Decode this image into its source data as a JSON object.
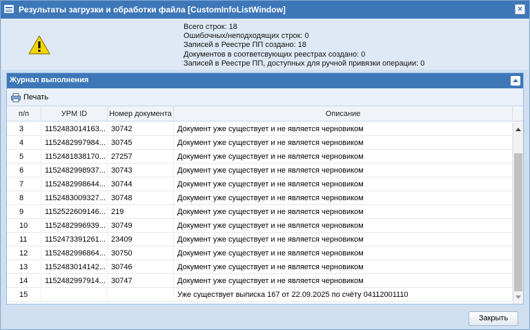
{
  "window": {
    "title": "Результаты загрузки и обработки файла [CustomInfoListWindow]"
  },
  "summary": {
    "lines": [
      "Всего строк: 18",
      "Ошибочных/неподходящих строк: 0",
      "Записей в Реестре ПП создано: 18",
      "Документов в соответсвующих реестрах создано: 0",
      "Записей в Реестре ПП, доступных для ручной привязки операции: 0"
    ],
    "icon": "warning-icon"
  },
  "journal": {
    "title": "Журнал выполнения",
    "toolbar": {
      "print_label": "Печать"
    },
    "columns": [
      "п/п",
      "УРМ ID",
      "Номер документа",
      "Описание"
    ],
    "rows": [
      {
        "num": "3",
        "uid": "1152483014163...",
        "doc": "30742",
        "desc": "Документ уже существует и не является черновиком"
      },
      {
        "num": "4",
        "uid": "1152482997984...",
        "doc": "30745",
        "desc": "Документ уже существует и не является черновиком"
      },
      {
        "num": "5",
        "uid": "1152481838170...",
        "doc": "27257",
        "desc": "Документ уже существует и не является черновиком"
      },
      {
        "num": "6",
        "uid": "1152482998937...",
        "doc": "30743",
        "desc": "Документ уже существует и не является черновиком"
      },
      {
        "num": "7",
        "uid": "1152482998644...",
        "doc": "30744",
        "desc": "Документ уже существует и не является черновиком"
      },
      {
        "num": "8",
        "uid": "1152483009327...",
        "doc": "30748",
        "desc": "Документ уже существует и не является черновиком"
      },
      {
        "num": "9",
        "uid": "1152522609146...",
        "doc": "219",
        "desc": "Документ уже существует и не является черновиком"
      },
      {
        "num": "10",
        "uid": "1152482996939...",
        "doc": "30749",
        "desc": "Документ уже существует и не является черновиком"
      },
      {
        "num": "11",
        "uid": "1152473391261...",
        "doc": "23409",
        "desc": "Документ уже существует и не является черновиком"
      },
      {
        "num": "12",
        "uid": "1152482996864...",
        "doc": "30750",
        "desc": "Документ уже существует и не является черновиком"
      },
      {
        "num": "13",
        "uid": "1152483014142...",
        "doc": "30746",
        "desc": "Документ уже существует и не является черновиком"
      },
      {
        "num": "14",
        "uid": "1152482997914...",
        "doc": "30747",
        "desc": "Документ уже существует и не является черновиком"
      },
      {
        "num": "15",
        "uid": "",
        "doc": "",
        "desc": "Уже существует выписка 167 от 22.09.2025 по счёту 04112001110"
      }
    ]
  },
  "footer": {
    "close_label": "Закрыть"
  },
  "colors": {
    "accent": "#3d77b8",
    "background": "#cfdff0"
  }
}
